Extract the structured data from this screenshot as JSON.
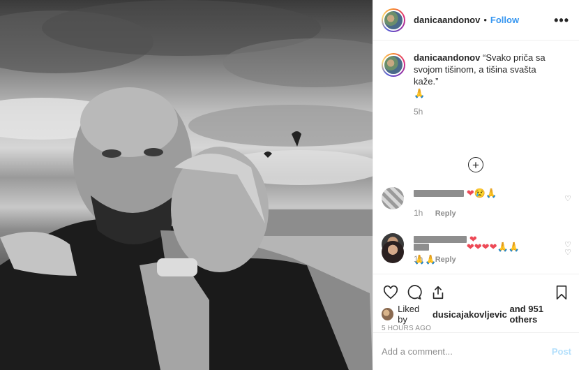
{
  "post": {
    "username": "danicaandonov",
    "follow_label": "Follow",
    "separator": "•",
    "more_label": "•••"
  },
  "caption": {
    "username": "danicaandonov",
    "text": "“Svako priča sa svojom tišinom, a tišina svašta kaže.”",
    "emoji": "🙏",
    "time": "5h"
  },
  "load_more_label": "+",
  "comments": [
    {
      "text": "❤😢🙏",
      "time": "1h",
      "reply": "Reply"
    },
    {
      "text": "❤",
      "time": "1h",
      "reply": "Reply"
    },
    {
      "text": "❤❤❤❤🙏🙏",
      "text2": "🙏🙏"
    }
  ],
  "likes": {
    "prefix": "Liked by",
    "user": "dusicajakovljevic",
    "suffix": "and 951 others"
  },
  "timestamp": "5 HOURS AGO",
  "add_comment": {
    "placeholder": "Add a comment...",
    "post_label": "Post"
  },
  "icons": {
    "like": "heart-icon",
    "comment": "comment-icon",
    "share": "share-icon",
    "save": "bookmark-icon",
    "add": "plus-circle-icon"
  },
  "colors": {
    "follow": "#3897f0",
    "post_disabled": "#b2dffc",
    "meta": "#8e8e8e",
    "heart_emoji": "#ed4956"
  }
}
